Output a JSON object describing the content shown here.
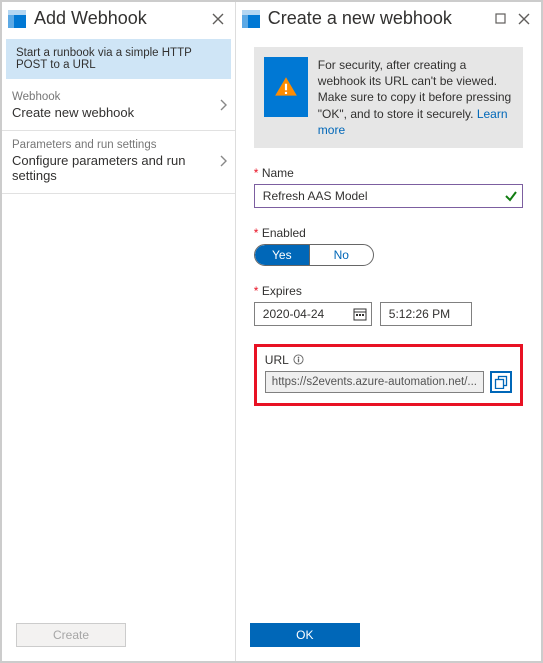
{
  "left": {
    "title": "Add Webhook",
    "description": "Start a runbook via a simple HTTP POST to a URL",
    "nav": [
      {
        "label": "Webhook",
        "value": "Create new webhook"
      },
      {
        "label": "Parameters and run settings",
        "value": "Configure parameters and run settings"
      }
    ],
    "createButton": "Create"
  },
  "right": {
    "title": "Create a new webhook",
    "info": {
      "text": "For security, after creating a webhook its URL can't be viewed. Make sure to copy it before pressing \"OK\", and to store it securely. ",
      "linkText": "Learn more"
    },
    "nameLabel": "Name",
    "nameValue": "Refresh AAS Model",
    "enabledLabel": "Enabled",
    "enabledYes": "Yes",
    "enabledNo": "No",
    "expiresLabel": "Expires",
    "expiresDate": "2020-04-24",
    "expiresTime": "5:12:26 PM",
    "urlLabel": "URL",
    "urlValue": "https://s2events.azure-automation.net/...",
    "okButton": "OK"
  }
}
